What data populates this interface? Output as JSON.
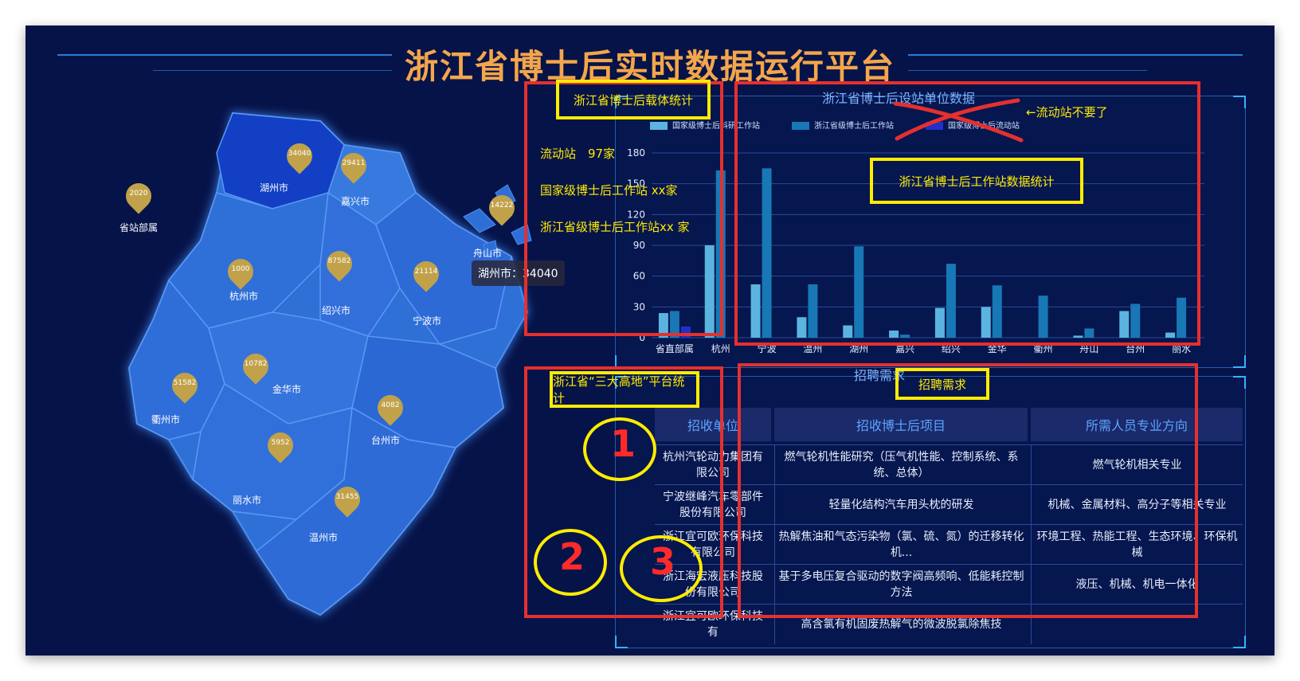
{
  "page": {
    "title": "浙江省博士后实时数据运行平台",
    "tooltip": "湖州市：34040"
  },
  "map": {
    "cities": [
      {
        "name": "湖州市",
        "value": "34040"
      },
      {
        "name": "嘉兴市",
        "value": "29411"
      },
      {
        "name": "舟山市",
        "value": "14222"
      },
      {
        "name": "省站部属",
        "value": "2020"
      },
      {
        "name": "杭州市",
        "value": "1000"
      },
      {
        "name": "绍兴市",
        "value": "87582"
      },
      {
        "name": "宁波市",
        "value": "21114"
      },
      {
        "name": "金华市",
        "value": "10782"
      },
      {
        "name": "衢州市",
        "value": "51582"
      },
      {
        "name": "台州市",
        "value": "4082"
      },
      {
        "name": "丽水市",
        "value": "5952"
      },
      {
        "name": "温州市",
        "value": "31455"
      }
    ]
  },
  "carrier_panel": {
    "title": "浙江省博士后载体统计",
    "lines": [
      "流动站　97家",
      "国家级博士后工作站 xx家",
      "浙江省级博士后工作站xx 家"
    ]
  },
  "chart_panel": {
    "title": "浙江省博士后设站单位数据",
    "note": "←流动站不要了",
    "overlay_title": "浙江省博士后工作站数据统计",
    "legend": [
      "国家级博士后科研工作站",
      "浙江省级博士后工作站",
      "国家级博士后流动站"
    ]
  },
  "chart_data": {
    "type": "bar",
    "categories": [
      "省直部属",
      "杭州",
      "宁波",
      "温州",
      "湖州",
      "嘉兴",
      "绍兴",
      "金华",
      "衢州",
      "舟山",
      "台州",
      "丽水"
    ],
    "series": [
      {
        "name": "国家级博士后科研工作站",
        "color": "#5ab4df",
        "values": [
          24,
          90,
          52,
          20,
          12,
          7,
          29,
          30,
          0,
          2,
          26,
          5
        ]
      },
      {
        "name": "浙江省级博士后工作站",
        "color": "#1778b5",
        "values": [
          26,
          163,
          165,
          52,
          89,
          3,
          72,
          51,
          41,
          9,
          33,
          39
        ]
      },
      {
        "name": "国家级博士后流动站",
        "color": "#2030c8",
        "values": [
          11,
          0,
          0,
          0,
          0,
          0,
          0,
          0,
          0,
          0,
          0,
          0
        ]
      }
    ],
    "yticks": [
      0,
      30,
      60,
      90,
      120,
      150,
      180
    ],
    "ylim": [
      0,
      180
    ]
  },
  "talent_panel": {
    "title": "浙江省“三大高地”平台统计",
    "circle_labels": [
      "1",
      "2",
      "3"
    ]
  },
  "recruit_panel": {
    "header_cut": "招聘需求",
    "overlay_title": "招聘需求",
    "headers": [
      "招收单位",
      "招收博士后项目",
      "所需人员专业方向"
    ],
    "rows": [
      [
        "杭州汽轮动力集团有限公司",
        "燃气轮机性能研究（压气机性能、控制系统、系统、总体）",
        "燃气轮机相关专业"
      ],
      [
        "宁波继峰汽车零部件股份有限公司",
        "轻量化结构汽车用头枕的研发",
        "机械、金属材料、高分子等相关专业"
      ],
      [
        "浙江宜可欧环保科技有限公司",
        "热解焦油和气态污染物（氯、硫、氮）的迁移转化机...",
        "环境工程、热能工程、生态环境、环保机械"
      ],
      [
        "浙江海宏液压科技股份有限公司",
        "基于多电压复合驱动的数字阀高频响、低能耗控制方法",
        "液压、机械、机电一体化"
      ],
      [
        "浙江宜可欧环保科技有",
        "高含氯有机固废热解气的微波脱氯除焦技",
        ""
      ]
    ]
  }
}
